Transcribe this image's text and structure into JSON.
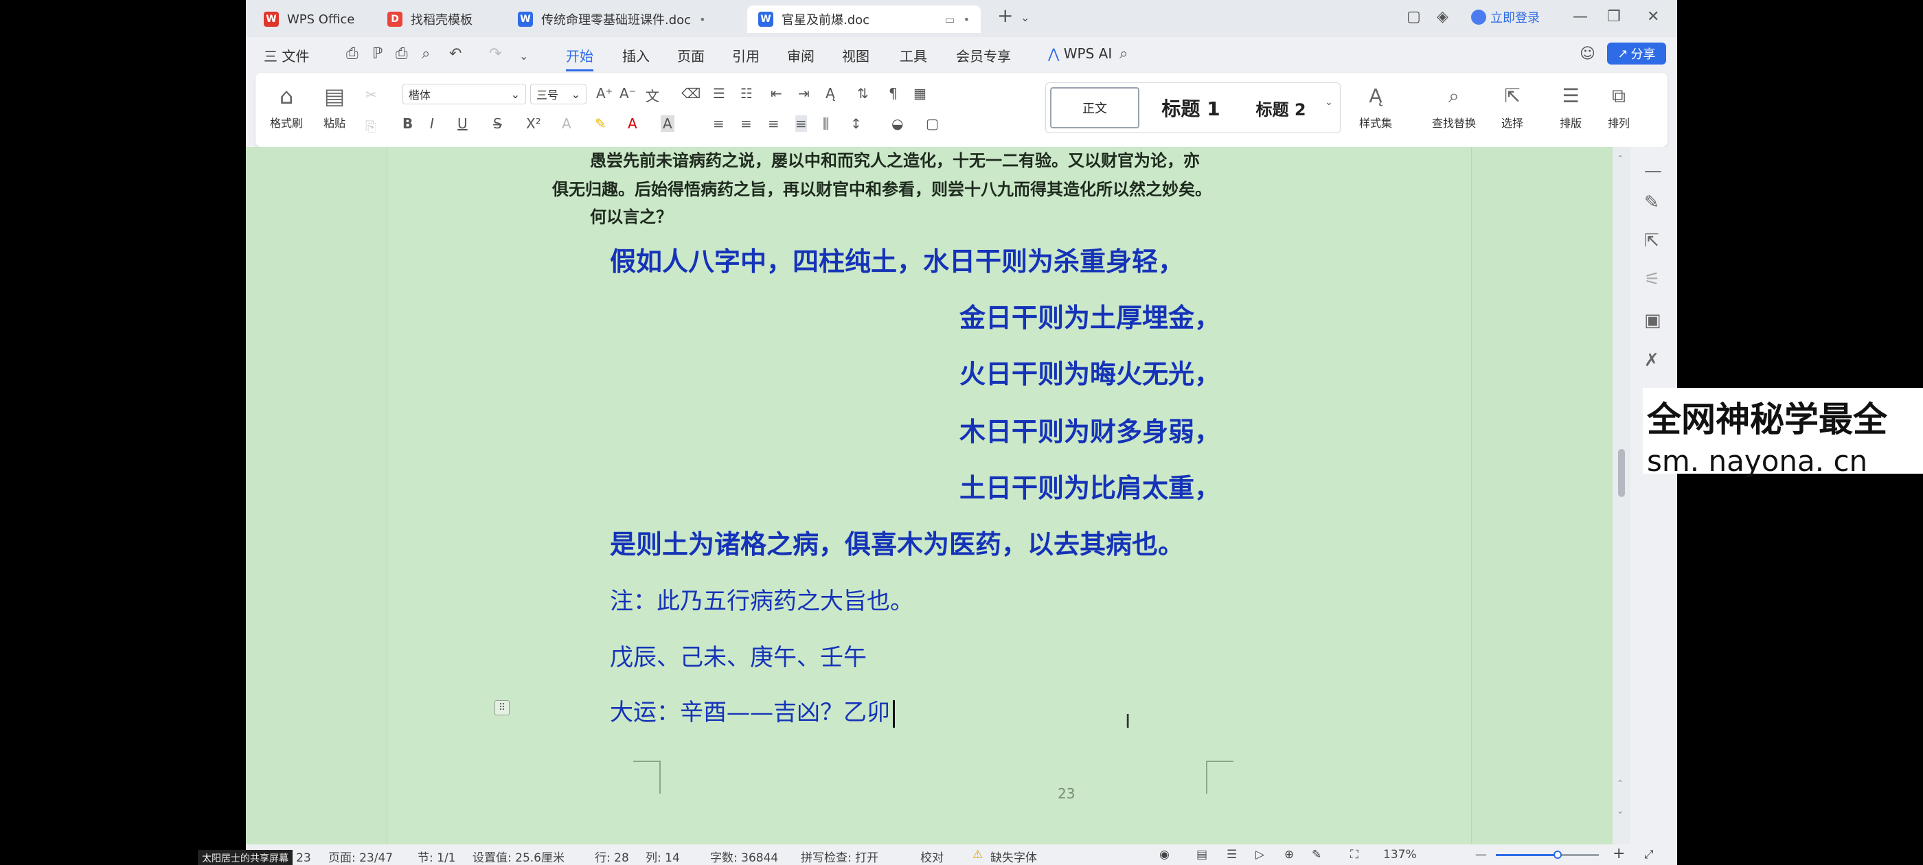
{
  "titlebar": {
    "tabs": [
      {
        "label": "WPS Office",
        "icon": "wps-logo-icon",
        "color": "#e0352b",
        "active": false
      },
      {
        "label": "找稻壳模板",
        "icon": "docer-icon",
        "color": "#e9453b",
        "active": false
      },
      {
        "label": "传统命理零基础班课件.doc",
        "icon": "word-doc-icon",
        "color": "#2e6be6",
        "active": false
      },
      {
        "label": "官星及前爆.doc",
        "icon": "word-doc-icon",
        "color": "#2e6be6",
        "active": true
      }
    ],
    "login_label": "立即登录"
  },
  "menubar": {
    "file_label": "三 文件",
    "items": [
      "开始",
      "插入",
      "页面",
      "引用",
      "审阅",
      "视图",
      "工具",
      "会员专享"
    ],
    "active": "开始",
    "wps_ai_label": "WPS AI",
    "share_label": "分享"
  },
  "ribbon": {
    "format_painter": "格式刷",
    "paste": "粘贴",
    "font_name": "楷体",
    "font_size": "三号",
    "styles": {
      "normal": "正文",
      "heading1": "标题 1",
      "heading2": "标题 2"
    },
    "style_set": "样式集",
    "find_replace": "查找替换",
    "select": "选择",
    "layout": "排版",
    "arrange": "排列"
  },
  "document": {
    "intro_lines": [
      "愚尝先前未谙病药之说，屡以中和而究人之造化，十无一二有验。又以财官为论，亦",
      "俱无归趣。后始得悟病药之旨，再以财官中和参看，则尝十八九而得其造化所以然之妙矣。",
      "何以言之？"
    ],
    "verse": [
      "假如人八字中，四柱纯土，水日干则为杀重身轻，",
      "金日干则为土厚埋金，",
      "火日干则为晦火无光，",
      "木日干则为财多身弱，",
      "土日干则为比肩太重，",
      "是则土为诸格之病，俱喜木为医药，以去其病也。"
    ],
    "note": "注：此乃五行病药之大旨也。",
    "example": "戊辰、己未、庚午、壬午",
    "luck": "大运：辛酉——吉凶？乙卯",
    "page_number": "23"
  },
  "statusbar": {
    "page": "页码: 23",
    "pages": "页面: 23/47",
    "section": "节: 1/1",
    "setting": "设置值: 25.6厘米",
    "row": "行: 28",
    "col": "列: 14",
    "words": "字数: 36844",
    "spellcheck": "拼写检查: 打开",
    "proof": "校对",
    "missing_font": "缺失字体",
    "zoom": "137%",
    "zoom_fraction": 0.6
  },
  "overlay": {
    "sharer": "太阳居士的共享屏幕",
    "watermark_line1": "全网神秘学最全",
    "watermark_line2": "sm. nayona. cn"
  }
}
